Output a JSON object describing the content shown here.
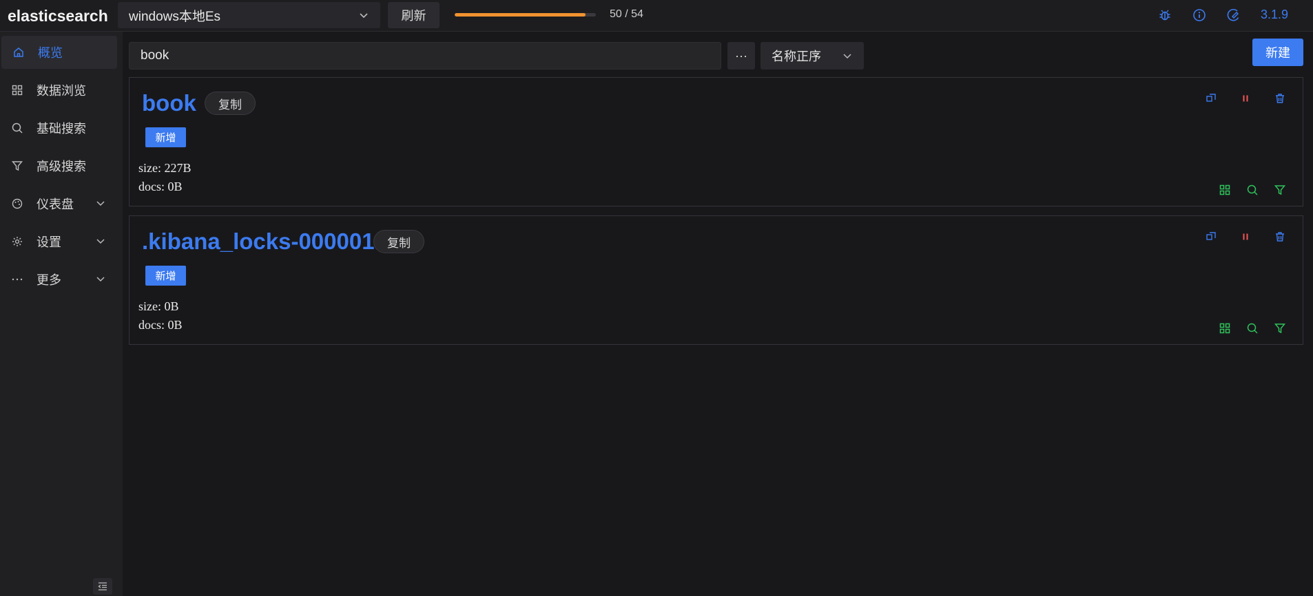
{
  "header": {
    "brand": "elasticsearch",
    "connection": "windows本地Es",
    "refresh_label": "刷新",
    "progress": {
      "current": 50,
      "total": 54,
      "text": "50 / 54",
      "color": "#f0922e"
    },
    "icons": [
      "bug-icon",
      "info-icon",
      "theme-icon"
    ],
    "version": "3.1.9"
  },
  "sidebar": {
    "items": [
      {
        "label": "概览",
        "icon": "home-icon",
        "active": true
      },
      {
        "label": "数据浏览",
        "icon": "grid-icon"
      },
      {
        "label": "基础搜索",
        "icon": "search-icon"
      },
      {
        "label": "高级搜索",
        "icon": "filter-icon"
      },
      {
        "label": "仪表盘",
        "icon": "palette-icon",
        "expandable": true
      },
      {
        "label": "设置",
        "icon": "gear-icon",
        "expandable": true
      },
      {
        "label": "更多",
        "icon": "ellipsis-icon",
        "expandable": true
      }
    ]
  },
  "toolbar": {
    "search_value": "book",
    "more_label": "···",
    "sort_label": "名称正序",
    "new_label": "新建"
  },
  "indices": [
    {
      "name": "book",
      "copy_label": "复制",
      "tag_label": "新增",
      "size": "size: 227B",
      "docs": "docs: 0B"
    },
    {
      "name": ".kibana_locks-000001",
      "copy_label": "复制",
      "tag_label": "新增",
      "size": "size: 0B",
      "docs": "docs: 0B"
    }
  ],
  "colors": {
    "accent": "#3c7bf0",
    "danger": "#f25656",
    "success": "#2fc25b",
    "warning": "#f0922e"
  }
}
